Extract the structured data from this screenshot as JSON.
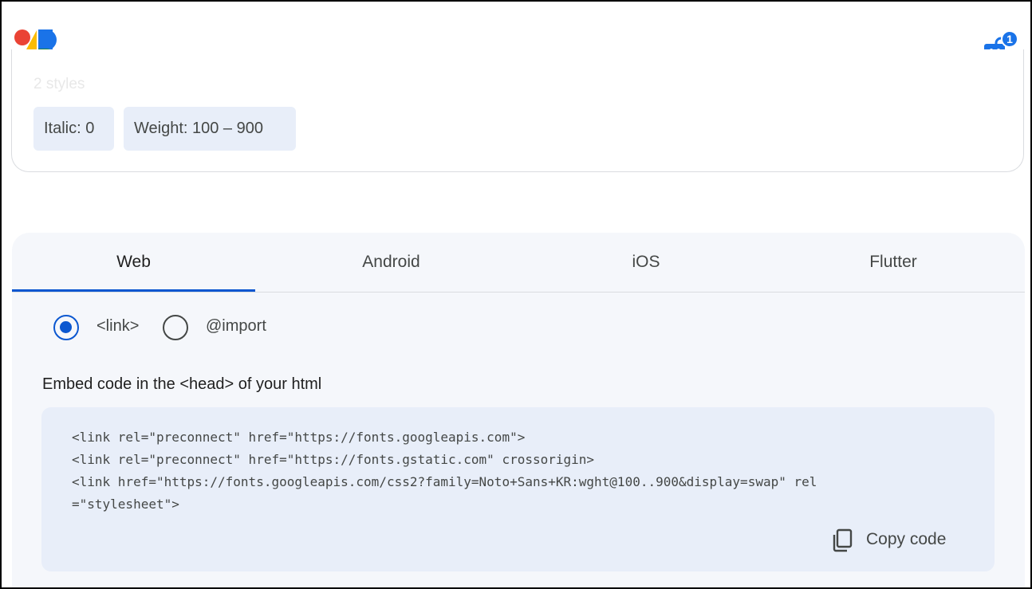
{
  "header": {
    "logo_icon": "google-fonts-logo",
    "bag_icon": "shopping-bag-icon",
    "bag_count": "1"
  },
  "styles": {
    "count_label": "2 styles",
    "chips": [
      "Italic: 0",
      "Weight: 100 – 900"
    ]
  },
  "tabs": [
    {
      "label": "Web",
      "active": true
    },
    {
      "label": "Android",
      "active": false
    },
    {
      "label": "iOS",
      "active": false
    },
    {
      "label": "Flutter",
      "active": false
    }
  ],
  "embed_type": {
    "options": [
      {
        "label": "<link>",
        "checked": true
      },
      {
        "label": "@import",
        "checked": false
      }
    ]
  },
  "embed": {
    "instruction": "Embed code in the <head> of your html",
    "code_lines": [
      "<link rel=\"preconnect\" href=\"https://fonts.googleapis.com\">",
      "<link rel=\"preconnect\" href=\"https://fonts.gstatic.com\" crossorigin>",
      "<link href=\"https://fonts.googleapis.com/css2?family=Noto+Sans+KR:wght@100..900&display=swap\" rel",
      "=\"stylesheet\">"
    ],
    "copy_label": "Copy code"
  },
  "colors": {
    "accent": "#0b57d0",
    "chip_bg": "#e8eef9",
    "panel_bg": "#f5f7fb",
    "badge_blue": "#1a73e8"
  }
}
